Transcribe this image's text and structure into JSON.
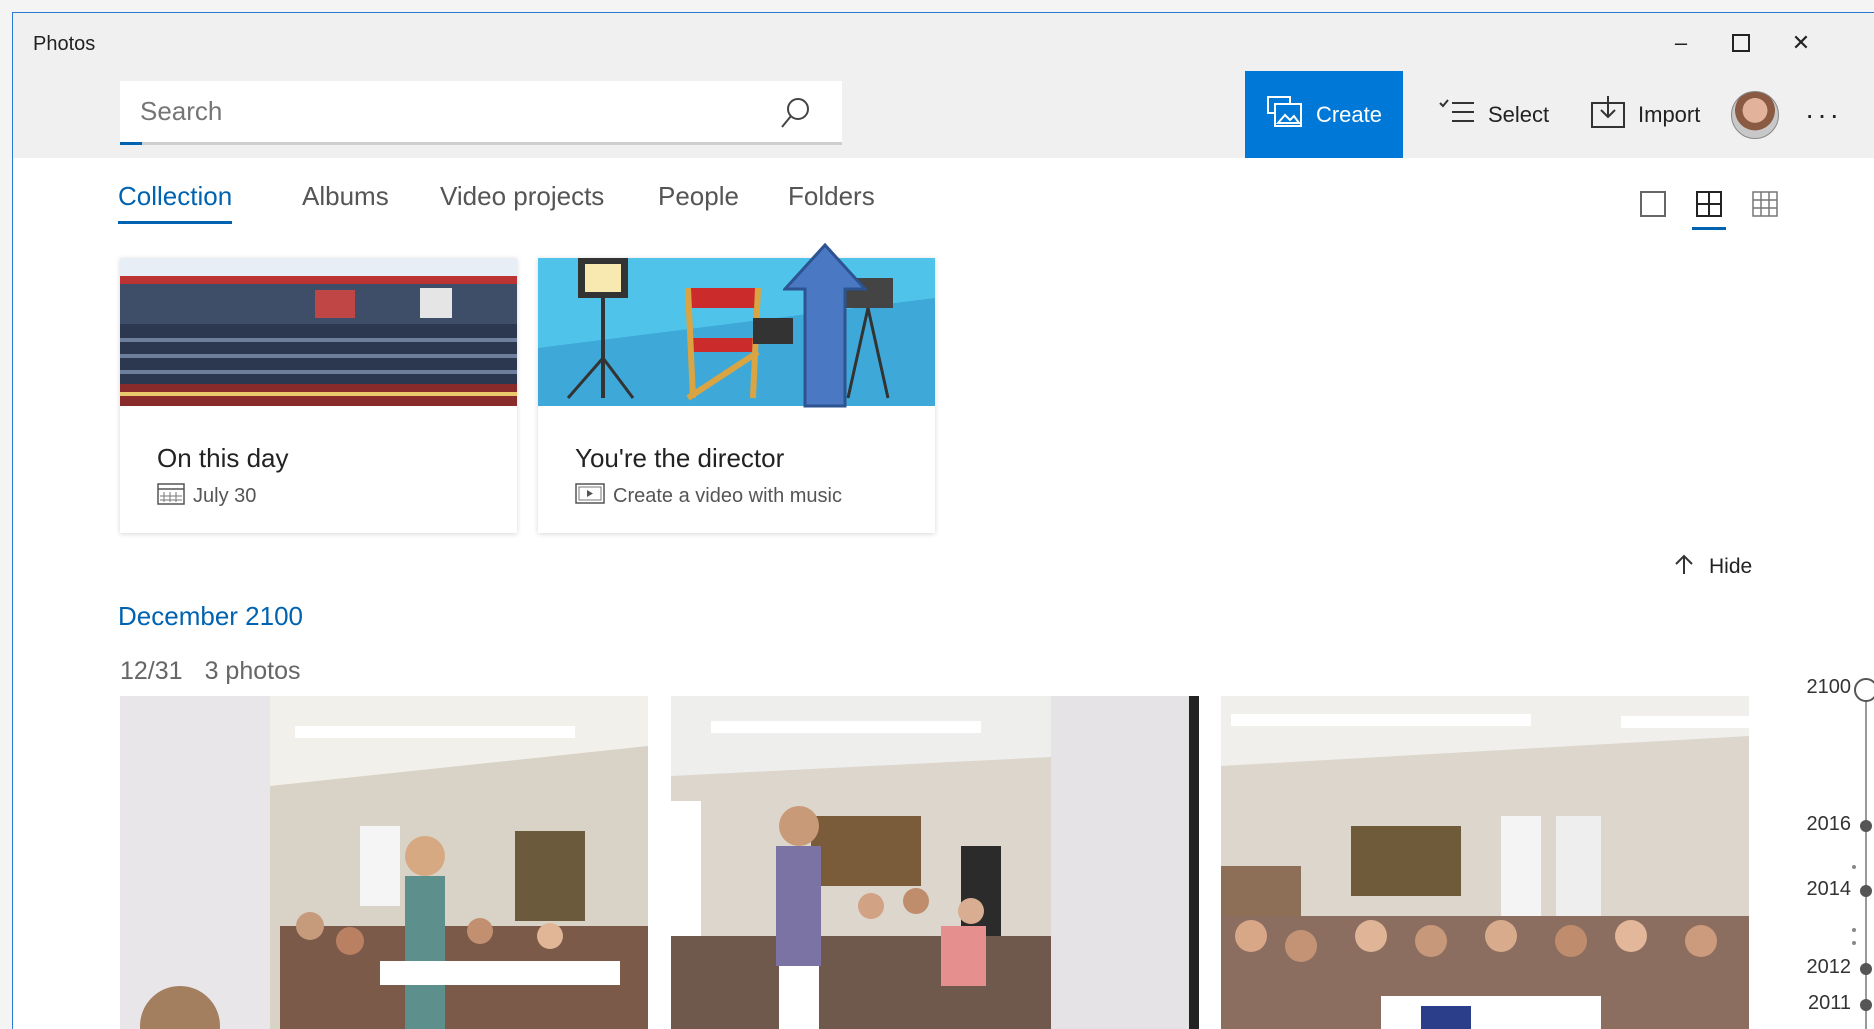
{
  "window": {
    "title": "Photos"
  },
  "controls": {
    "minimize": "–",
    "maximize": "☐",
    "close": "✕"
  },
  "search": {
    "placeholder": "Search",
    "value": ""
  },
  "toolbar": {
    "create_label": "Create",
    "select_label": "Select",
    "import_label": "Import",
    "more_label": "···"
  },
  "tabs": [
    {
      "label": "Collection",
      "active": true
    },
    {
      "label": "Albums"
    },
    {
      "label": "Video projects"
    },
    {
      "label": "People"
    },
    {
      "label": "Folders"
    }
  ],
  "cards": [
    {
      "title": "On this day",
      "subtitle": "July 30",
      "icon": "calendar-icon"
    },
    {
      "title": "You're the director",
      "subtitle": "Create a video with music",
      "icon": "video-icon"
    }
  ],
  "hide_label": "Hide",
  "month_label": "December 2100",
  "day_label": "12/31",
  "photo_count": "3 photos",
  "timeline": [
    "2100",
    "2016",
    "2014",
    "2012",
    "2011"
  ],
  "colors": {
    "accent": "#0078d7",
    "accent_text": "#0063b1"
  }
}
